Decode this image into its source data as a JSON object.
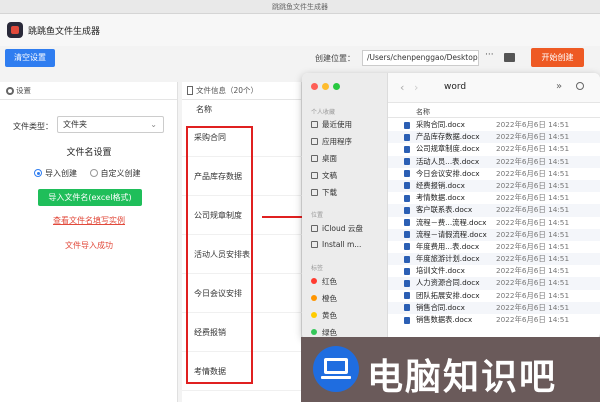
{
  "window": {
    "title": "跳跳鱼文件生成器"
  },
  "app": {
    "name": "跳跳鱼文件生成器"
  },
  "toolbar": {
    "clear_label": "清空设置",
    "location_label": "创建位置：",
    "path_value": "/Users/chenpenggao/Desktop",
    "more_label": "···",
    "start_label": "开始创建"
  },
  "settings": {
    "header": "设置",
    "file_type_label": "文件类型：",
    "file_type_value": "文件夹",
    "filename_section": "文件名设置",
    "radio_import": "导入创建",
    "radio_custom": "自定义创建",
    "import_button": "导入文件名(excel格式)",
    "example_link": "查看文件名填写实例",
    "import_status": "文件导入成功"
  },
  "file_info": {
    "header": "文件信息（20个）",
    "column_name": "名称",
    "items": [
      "采购合同",
      "产品库存数据",
      "公司规章制度",
      "活动人员安排表",
      "今日会议安排",
      "经费报销",
      "考情数据"
    ]
  },
  "finder": {
    "title": "word",
    "column_name": "名称",
    "sidebar": {
      "section_personal": "个人收藏",
      "recent": "最近使用",
      "apps": "应用程序",
      "desktop": "桌面",
      "documents": "文稿",
      "downloads": "下载",
      "section_location": "位置",
      "icloud": "iCloud 云盘",
      "install": "Install m...",
      "section_tags": "标签",
      "tag_red": "红色",
      "tag_orange": "橙色",
      "tag_yellow": "黄色",
      "tag_green": "绿色"
    },
    "files": [
      {
        "name": "采购合同.docx",
        "date": "2022年6月6日 14:51"
      },
      {
        "name": "产品库存数据.docx",
        "date": "2022年6月6日 14:51"
      },
      {
        "name": "公司规章制度.docx",
        "date": "2022年6月6日 14:51"
      },
      {
        "name": "活动人员...表.docx",
        "date": "2022年6月6日 14:51"
      },
      {
        "name": "今日会议安排.docx",
        "date": "2022年6月6日 14:51"
      },
      {
        "name": "经费报销.docx",
        "date": "2022年6月6日 14:51"
      },
      {
        "name": "考情数据.docx",
        "date": "2022年6月6日 14:51"
      },
      {
        "name": "客户联系表.docx",
        "date": "2022年6月6日 14:51"
      },
      {
        "name": "流程－费...流程.docx",
        "date": "2022年6月6日 14:51"
      },
      {
        "name": "流程－请假流程.docx",
        "date": "2022年6月6日 14:51"
      },
      {
        "name": "年度费用...表.docx",
        "date": "2022年6月6日 14:51"
      },
      {
        "name": "年度旅游计划.docx",
        "date": "2022年6月6日 14:51"
      },
      {
        "name": "培训文件.docx",
        "date": "2022年6月6日 14:51"
      },
      {
        "name": "人力资源合同.docx",
        "date": "2022年6月6日 14:51"
      },
      {
        "name": "团队拓展安排.docx",
        "date": "2022年6月6日 14:51"
      },
      {
        "name": "销售合同.docx",
        "date": "2022年6月6日 14:51"
      },
      {
        "name": "销售数据表.docx",
        "date": "2022年6月6日 14:51"
      }
    ]
  },
  "watermark": {
    "text": "电脑知识吧"
  }
}
